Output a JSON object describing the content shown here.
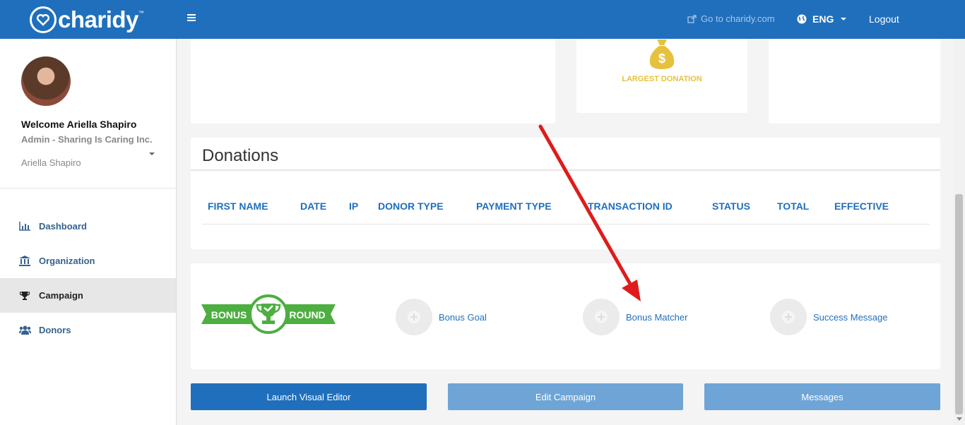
{
  "header": {
    "logo_text": "charidy",
    "logo_tm": "™",
    "goto_label": "Go to charidy.com",
    "language": "ENG",
    "logout_label": "Logout"
  },
  "sidebar": {
    "welcome": "Welcome Ariella Shapiro",
    "role": "Admin - Sharing Is Caring Inc.",
    "user_select": "Ariella Shapiro",
    "items": [
      {
        "label": "Dashboard",
        "icon": "bar-chart-icon"
      },
      {
        "label": "Organization",
        "icon": "bank-icon"
      },
      {
        "label": "Campaign",
        "icon": "trophy-icon",
        "active": true
      },
      {
        "label": "Donors",
        "icon": "users-icon"
      }
    ]
  },
  "stats": {
    "largest_donation_label": "LARGEST DONATION"
  },
  "donations": {
    "title": "Donations",
    "columns": [
      "FIRST NAME",
      "DATE",
      "IP",
      "DONOR TYPE",
      "PAYMENT TYPE",
      "TRANSACTION ID",
      "STATUS",
      "TOTAL",
      "EFFECTIVE"
    ]
  },
  "bonus_round": {
    "logo_left": "BONUS",
    "logo_right": "ROUND",
    "options": [
      "Bonus Goal",
      "Bonus Matcher",
      "Success Message"
    ]
  },
  "buttons": {
    "launch_visual_editor": "Launch Visual Editor",
    "edit_campaign": "Edit Campaign",
    "messages": "Messages"
  },
  "colors": {
    "brand_blue": "#1f6fbd",
    "bonus_green": "#4caf3f",
    "gold": "#e6c13d",
    "annotation_red": "#e01b1b"
  }
}
